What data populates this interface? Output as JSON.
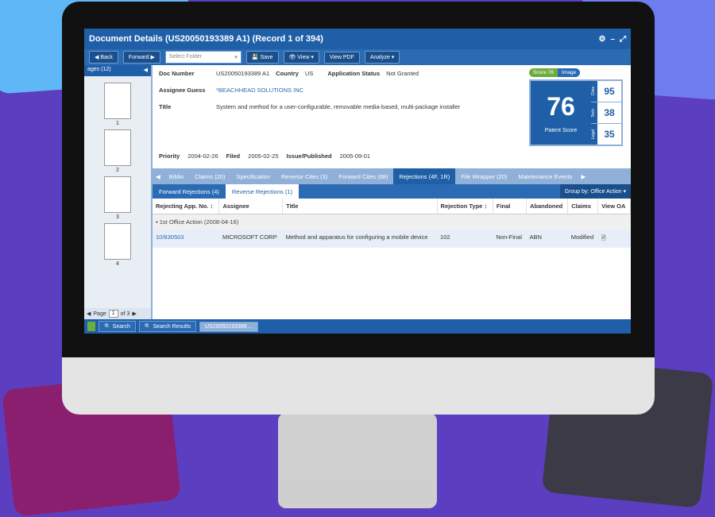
{
  "window": {
    "title": "Document Details (US20050193389 A1)  (Record 1 of 394)",
    "controls": [
      "⚙",
      "–",
      "⤢"
    ]
  },
  "toolbar": {
    "back": "◀ Back",
    "forward": "Forward ▶",
    "folder_placeholder": "Select Folder",
    "save": "💾 Save",
    "view": "👁 View ▾",
    "view_pdf": "View PDF",
    "analyze": "Analyze ▾"
  },
  "pages_panel": {
    "header": "ages (12)",
    "thumb_numbers": [
      "1",
      "2",
      "3",
      "4"
    ],
    "page_label": "Page",
    "page_value": "1",
    "page_total": "of 3"
  },
  "meta": {
    "doc_number_label": "Doc Number",
    "doc_number": "US20050193389 A1",
    "country_label": "Country",
    "country": "US",
    "app_status_label": "Application Status",
    "app_status": "Not Granted",
    "assignee_label": "Assignee Guess",
    "assignee": "*BEACHHEAD SOLUTIONS INC",
    "title_label": "Title",
    "title": "System and method for a user-configurable, removable media-based, multi-package installer",
    "priority_label": "Priority",
    "priority": "2004-02-26",
    "filed_label": "Filed",
    "filed": "2005-02-25",
    "issue_label": "Issue/Published",
    "issue": "2005-09-01"
  },
  "score": {
    "tab_score": "Score 76",
    "tab_image": "Image",
    "value": "76",
    "label": "Patent Score",
    "subs": [
      {
        "label": "Cites",
        "value": "95"
      },
      {
        "label": "Tech",
        "value": "38"
      },
      {
        "label": "Legal",
        "value": "35"
      }
    ]
  },
  "tabs": [
    "Biblio",
    "Claims (20)",
    "Specification",
    "Reverse Cites (3)",
    "Forward Cites (88)",
    "Rejections (4F, 1R)",
    "File Wrapper (20)",
    "Maintenance Events"
  ],
  "subtabs": [
    "Forward Rejections (4)",
    "Reverse Rejections (1)"
  ],
  "group_by": "Group by: Office Action ▾",
  "table": {
    "headers": [
      "Rejecting App. No. ↕",
      "Assignee",
      "Title",
      "Rejection Type ↕",
      "Final",
      "Abandoned",
      "Claims",
      "View OA"
    ],
    "group": "1st Office Action (2008-04-16)",
    "row": {
      "app_no": "10/830503",
      "assignee": "MICROSOFT CORP",
      "title": "Method and apparatus for configuring a mobile device",
      "rejection_type": "102",
      "final": "Non-Final",
      "abandoned": "ABN",
      "claims": "Modified"
    }
  },
  "statusbar": [
    "🔍 Search",
    "🔍 Search Results",
    "US20050193389 ..."
  ]
}
